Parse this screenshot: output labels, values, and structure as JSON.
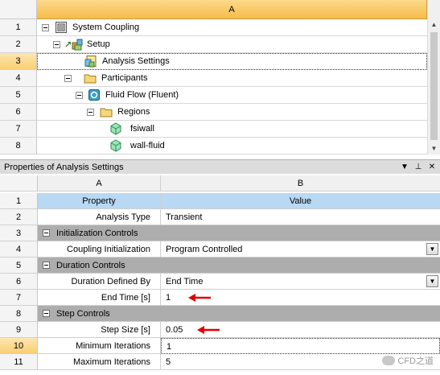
{
  "outline": {
    "column_header": "A",
    "rows": [
      {
        "num": "1",
        "label": "System Coupling",
        "icon": "system-coupling-icon"
      },
      {
        "num": "2",
        "label": "Setup",
        "icon": "setup-icon"
      },
      {
        "num": "3",
        "label": "Analysis Settings",
        "icon": "analysis-settings-icon",
        "selected": true
      },
      {
        "num": "4",
        "label": "Participants",
        "icon": "folder-icon"
      },
      {
        "num": "5",
        "label": "Fluid Flow (Fluent)",
        "icon": "fluent-icon"
      },
      {
        "num": "6",
        "label": "Regions",
        "icon": "folder-icon"
      },
      {
        "num": "7",
        "label": "fsiwall",
        "icon": "region-icon"
      },
      {
        "num": "8",
        "label": "wall-fluid",
        "icon": "region-icon"
      }
    ]
  },
  "properties": {
    "title": "Properties of Analysis Settings",
    "col_a": "A",
    "col_b": "B",
    "header_property": "Property",
    "header_value": "Value",
    "rows": [
      {
        "num": "2",
        "property": "Analysis Type",
        "value": "Transient"
      },
      {
        "num": "3",
        "group": "Initialization Controls"
      },
      {
        "num": "4",
        "property": "Coupling Initialization",
        "value": "Program Controlled",
        "dropdown": true
      },
      {
        "num": "5",
        "group": "Duration Controls"
      },
      {
        "num": "6",
        "property": "Duration Defined By",
        "value": "End Time",
        "dropdown": true
      },
      {
        "num": "7",
        "property": "End Time [s]",
        "value": "1"
      },
      {
        "num": "8",
        "group": "Step Controls"
      },
      {
        "num": "9",
        "property": "Step Size [s]",
        "value": "0.05"
      },
      {
        "num": "10",
        "property": "Minimum Iterations",
        "value": "1",
        "selected": true
      },
      {
        "num": "11",
        "property": "Maximum Iterations",
        "value": "5"
      }
    ],
    "header_row_num": "1"
  },
  "watermark": "CFD之道",
  "colors": {
    "header_orange": "#f6bc4a",
    "group_gray": "#adadad",
    "column_blue": "#b8d8f4",
    "arrow_red": "#e00000"
  }
}
